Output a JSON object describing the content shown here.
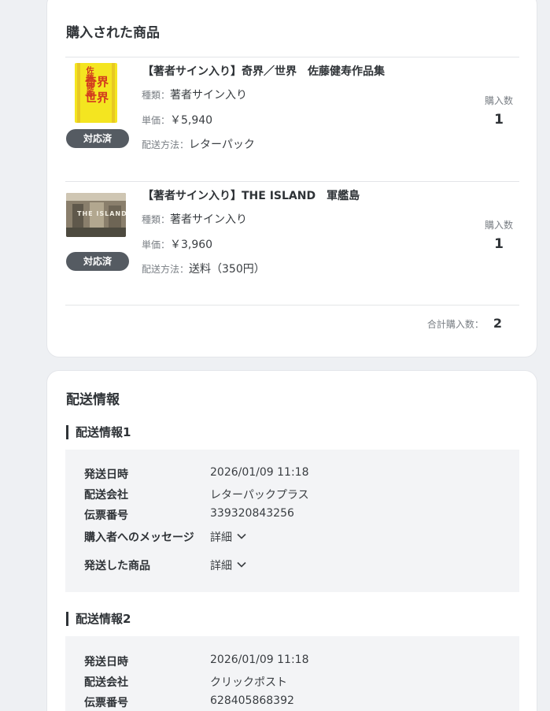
{
  "purchased": {
    "title": "購入された商品",
    "qty_label": "購入数",
    "items": [
      {
        "name": "【著者サイン入り】奇界／世界　佐藤健寿作品集",
        "status": "対応済",
        "type_label": "種類：",
        "type": "著者サイン入り",
        "price_label": "単価：",
        "price": "￥5,940",
        "shipping_label": "配送方法：",
        "shipping": "レターパック",
        "qty": "1",
        "cover_text": "奇界 世界",
        "cover_author": "佐藤健寿"
      },
      {
        "name": "【著者サイン入り】THE ISLAND　軍艦島",
        "status": "対応済",
        "type_label": "種類：",
        "type": "著者サイン入り",
        "price_label": "単価：",
        "price": "￥3,960",
        "shipping_label": "配送方法：",
        "shipping": "送料（350円）",
        "qty": "1",
        "cover_text": "THE ISLAND"
      }
    ],
    "total_label": "合計購入数：",
    "total": "2"
  },
  "shipping": {
    "title": "配送情報",
    "entries": [
      {
        "title": "配送情報1",
        "rows": [
          {
            "k": "発送日時",
            "v": "2026/01/09 11:18"
          },
          {
            "k": "配送会社",
            "v": "レターパックプラス"
          },
          {
            "k": "伝票番号",
            "v": "339320843256"
          },
          {
            "k": "購入者へのメッセージ",
            "v": "詳細"
          },
          {
            "k": "発送した商品",
            "v": "詳細"
          }
        ]
      },
      {
        "title": "配送情報2",
        "rows": [
          {
            "k": "発送日時",
            "v": "2026/01/09 11:18"
          },
          {
            "k": "配送会社",
            "v": "クリックポスト"
          },
          {
            "k": "伝票番号",
            "v": "628405868392"
          }
        ]
      }
    ]
  },
  "icons": {
    "expand": "chevron-down-icon"
  },
  "colors": {
    "badge": "#555b62",
    "page_bg": "#eef0f3",
    "cover_yellow": "#f4e520",
    "cover_red": "#d23a1e"
  }
}
